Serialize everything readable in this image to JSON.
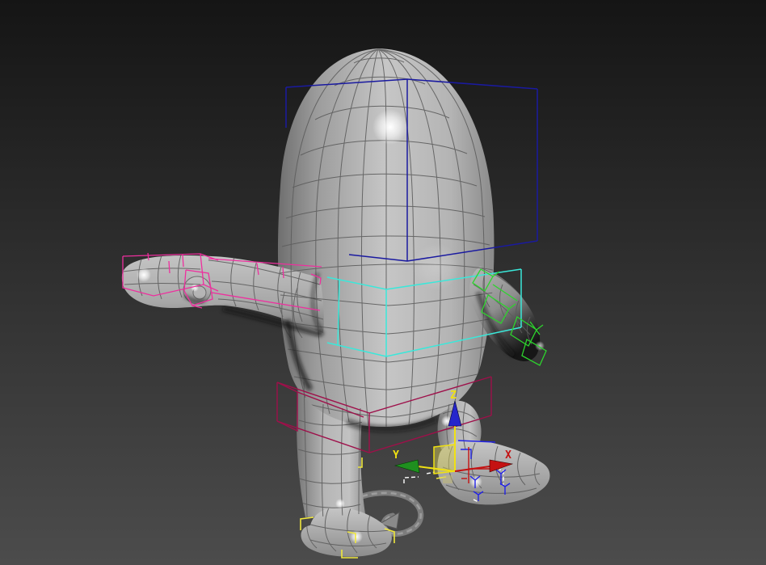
{
  "gizmo": {
    "x_label": "X",
    "y_label": "Y",
    "z_label": "Z"
  },
  "colors": {
    "background_top": "#151515",
    "background_bottom": "#4c4c4c",
    "mesh_fill": "#c6c6c6",
    "wireframe": "#5d5d5d",
    "head_selection_box": "#1a1aa0",
    "torso_selection_box": "#3ae8da",
    "left_arm_bones": "#ee2f9e",
    "pelvis_selection_box": "#9e104a",
    "right_arm_bones": "#2dd42d",
    "left_foot_brackets": "#efe73c",
    "right_foot_brackets": "#ffffff",
    "vertex_ticks_blue": "#2222e6",
    "gizmo_x": "#c41212",
    "gizmo_y_cone": "#1f8f1f",
    "gizmo_z_cone": "#2525cc",
    "gizmo_active": "#f0e112",
    "gizmo_plane_fill": "#cfc75a",
    "tail_spline": "#7d7d7d"
  }
}
